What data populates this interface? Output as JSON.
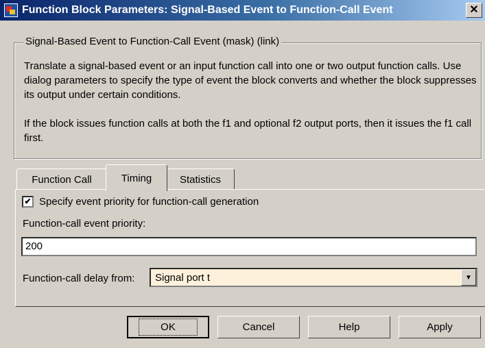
{
  "window": {
    "title": "Function Block Parameters: Signal-Based Event to Function-Call Event",
    "close_label": "✕"
  },
  "group": {
    "title": "Signal-Based Event to Function-Call Event (mask) (link)",
    "paragraph1": "Translate a signal-based event or an input function call into one or two output function calls. Use dialog parameters to specify the type of event the block converts and whether the block suppresses its output under certain conditions.",
    "paragraph2": "If the block issues function calls at both the f1 and optional f2 output ports, then it issues the f1 call first."
  },
  "tabs": [
    {
      "label": "Function Call"
    },
    {
      "label": "Timing"
    },
    {
      "label": "Statistics"
    }
  ],
  "timing": {
    "checkbox_label": "Specify event priority for function-call generation",
    "checkbox_checked": true,
    "priority_label": "Function-call event priority:",
    "priority_value": "200",
    "delay_label": "Function-call delay from:",
    "delay_value": "Signal port t"
  },
  "buttons": {
    "ok": "OK",
    "cancel": "Cancel",
    "help": "Help",
    "apply": "Apply"
  }
}
